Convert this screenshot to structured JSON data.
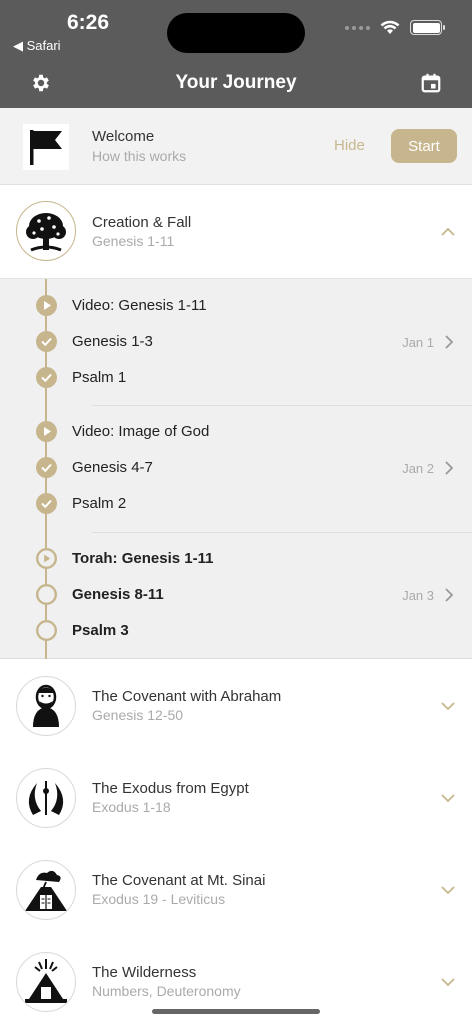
{
  "status": {
    "time": "6:26",
    "back_label": "◀ Safari"
  },
  "nav": {
    "title": "Your Journey",
    "gear_icon": "gear-icon",
    "calendar_icon": "calendar-icon"
  },
  "welcome": {
    "title": "Welcome",
    "subtitle": "How this works",
    "hide_label": "Hide",
    "start_label": "Start"
  },
  "colors": {
    "accent": "#c7b68d",
    "header_bg": "#5b5b5b"
  },
  "sections": [
    {
      "title": "Creation & Fall",
      "subtitle": "Genesis 1-11",
      "icon": "tree-icon",
      "expanded": true
    },
    {
      "title": "The Covenant with Abraham",
      "subtitle": "Genesis 12-50",
      "icon": "abraham-icon",
      "expanded": false
    },
    {
      "title": "The Exodus from Egypt",
      "subtitle": "Exodus 1-18",
      "icon": "exodus-icon",
      "expanded": false
    },
    {
      "title": "The Covenant at Mt. Sinai",
      "subtitle": "Exodus 19 - Leviticus",
      "icon": "sinai-icon",
      "expanded": false
    },
    {
      "title": "The Wilderness",
      "subtitle": "Numbers, Deuteronomy",
      "icon": "wilderness-icon",
      "expanded": false
    }
  ],
  "readings": [
    {
      "label": "Video: Genesis 1-11",
      "type": "video",
      "done": true,
      "date": ""
    },
    {
      "label": "Genesis 1-3",
      "type": "reading",
      "done": true,
      "date": "Jan 1"
    },
    {
      "label": "Psalm 1",
      "type": "reading",
      "done": true,
      "date": ""
    },
    {
      "label": "Video: Image of God",
      "type": "video",
      "done": true,
      "date": ""
    },
    {
      "label": "Genesis 4-7",
      "type": "reading",
      "done": true,
      "date": "Jan 2"
    },
    {
      "label": "Psalm 2",
      "type": "reading",
      "done": true,
      "date": ""
    },
    {
      "label": "Torah: Genesis 1-11",
      "type": "video",
      "done": false,
      "date": ""
    },
    {
      "label": "Genesis 8-11",
      "type": "reading",
      "done": false,
      "date": "Jan 3"
    },
    {
      "label": "Psalm 3",
      "type": "reading",
      "done": false,
      "date": ""
    }
  ]
}
